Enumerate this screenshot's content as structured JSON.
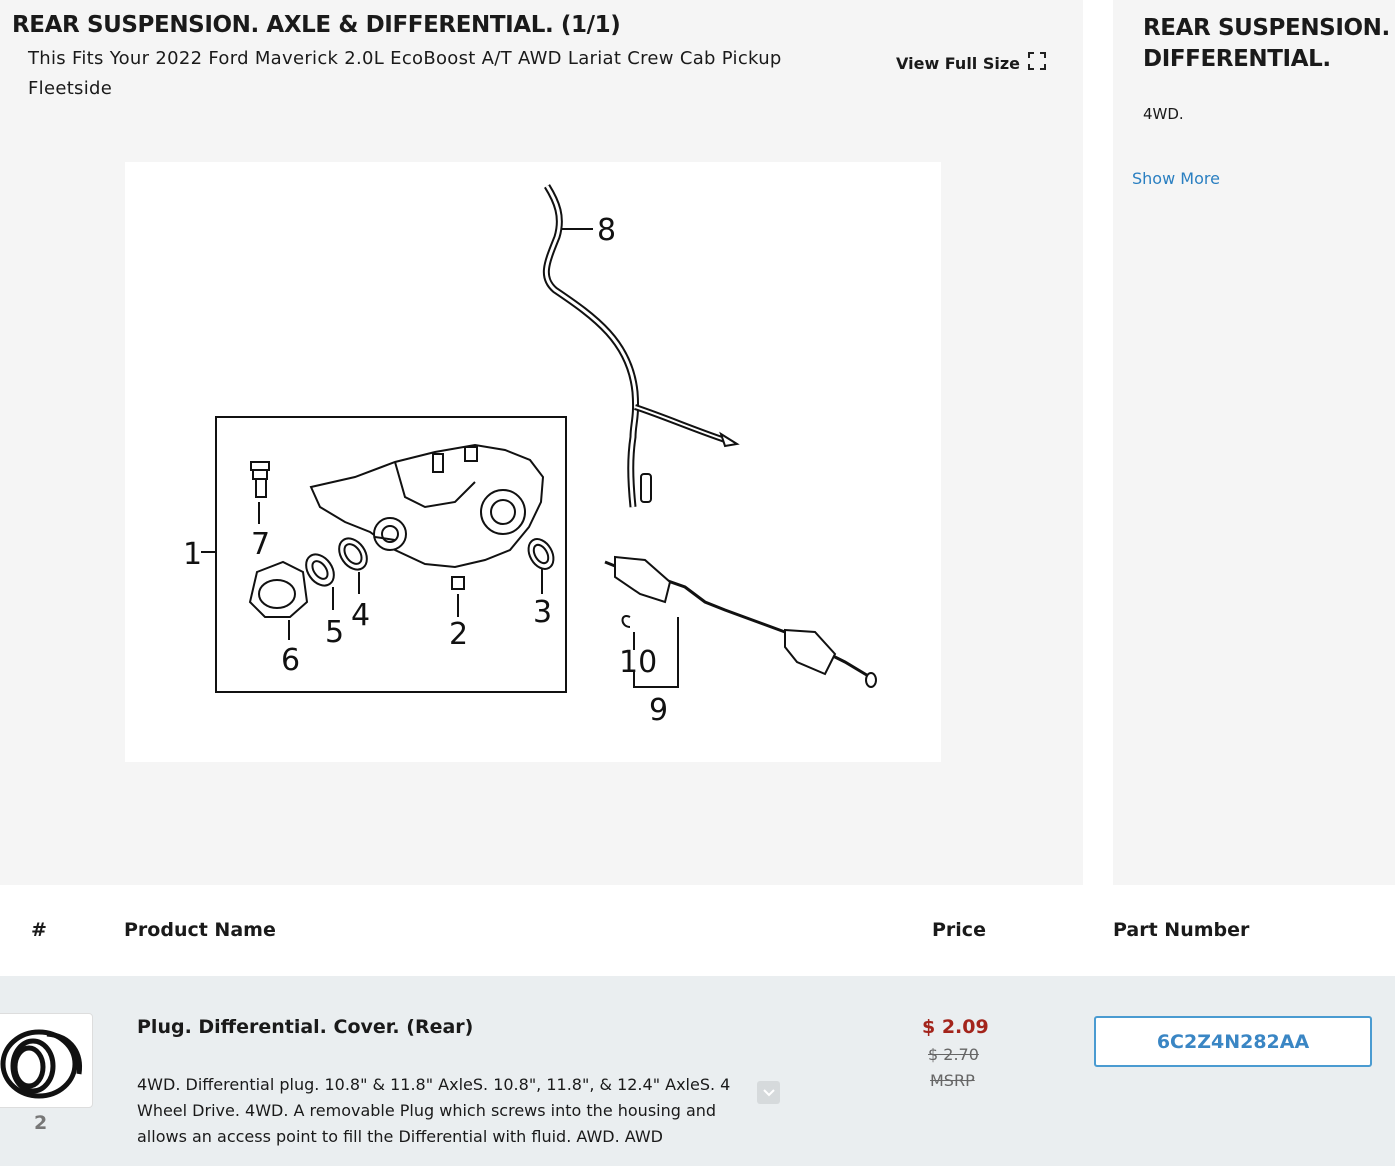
{
  "diagram_panel": {
    "title": "REAR SUSPENSION. AXLE & DIFFERENTIAL. (1/1)",
    "fitment": "This Fits Your 2022 Ford Maverick 2.0L EcoBoost A/T AWD Lariat Crew Cab Pickup Fleetside",
    "view_full_size": "View Full Size",
    "callouts": [
      "1",
      "2",
      "3",
      "4",
      "5",
      "6",
      "7",
      "8",
      "9",
      "10"
    ]
  },
  "side_panel": {
    "title_line1": "REAR SUSPENSION. AXLE &",
    "title_line2": "DIFFERENTIAL.",
    "description": "4WD.",
    "show_more": "Show More"
  },
  "table": {
    "headers": {
      "num": "#",
      "product_name": "Product Name",
      "price": "Price",
      "part_number": "Part Number"
    },
    "rows": [
      {
        "num": "2",
        "name": "Plug. Differential. Cover. (Rear)",
        "description": "4WD. Differential plug. 10.8\" & 11.8\" AxleS. 10.8\", 11.8\", & 12.4\" AxleS. 4 Wheel Drive. 4WD. A removable Plug which screws into the housing and allows an access point to fill the Differential with fluid. AWD. AWD",
        "price": "$ 2.09",
        "list_price": "$ 2.70",
        "msrp_label": "MSRP",
        "part_number": "6C2Z4N282AA"
      }
    ]
  },
  "icons": {
    "fullscreen": "fullscreen-icon",
    "expand": "chevron-down-icon"
  },
  "colors": {
    "price": "#a3241b",
    "link": "#2a7fc1",
    "part_border": "#4a9bd1",
    "panel_bg": "#f5f5f5",
    "row_bg": "#eaeef0"
  }
}
